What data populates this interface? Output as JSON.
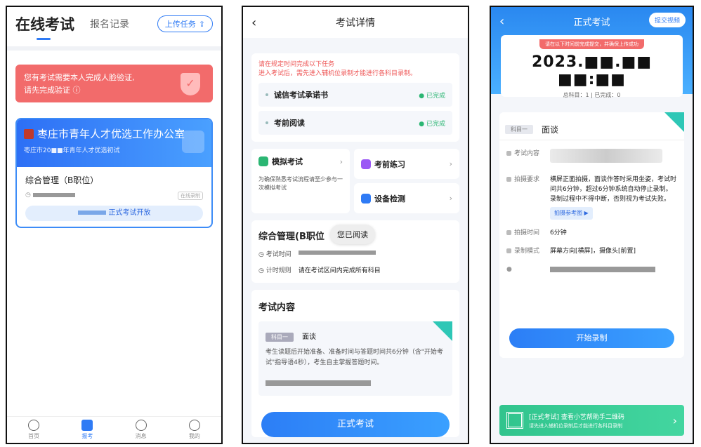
{
  "p1": {
    "title": "在线考试",
    "tab2": "报名记录",
    "upload": "上传任务",
    "alert_line1": "您有考试需要本人完成人脸验证,",
    "alert_line2": "请先完成验证",
    "org": "枣庄市青年人才优选工作办公室",
    "org_sub": "枣庄市20■■年青年人才优选初试",
    "subject": "综合管理（B职位）",
    "rec_tag": "在线录制",
    "open": "正式考试开放",
    "tabs": [
      "首页",
      "报考",
      "消息",
      "我的"
    ]
  },
  "p2": {
    "title": "考试详情",
    "note1": "请在规定时间完成以下任务",
    "note2": "进入考试后，需先进入辅机位录制才能进行各科目录制。",
    "tasks": [
      {
        "label": "诚信考试承诺书",
        "status": "已完成"
      },
      {
        "label": "考前阅读",
        "status": "已完成"
      }
    ],
    "mock": "模拟考试",
    "mock_desc": "为确保熟悉考试流程请至少参与一次模拟考试",
    "practice": "考前练习",
    "device": "设备检测",
    "info_title": "综合管理(B职位",
    "bubble": "您已阅读",
    "exam_time_k": "考试时间",
    "timing_k": "计时规则",
    "timing_v": "请在考试区间内完成所有科目",
    "content_title": "考试内容",
    "subj_tag": "科目一",
    "subj_name": "面谈",
    "subj_desc": "考生读题后开始准备、准备时间与答题时间共6分钟（含\"开始考试\"指导语4秒），考生自主掌握答题时间。",
    "start": "正式考试"
  },
  "p3": {
    "title": "正式考试",
    "submit": "提交视频",
    "banner": "请在以下时间前完成提交，并确保上传成功",
    "date": "2023.■■.■■ ■■:■■",
    "count": "总科目：1 | 已完成：0",
    "subj_tag": "科目一",
    "subj_name": "面谈",
    "k_content": "考试内容",
    "k_req": "拍摄要求",
    "v_req": "横屏正面拍摄，面谈作答时采用坐姿，考试时间共6分钟，超过6分钟系统自动停止录制。录制过程中不得中断，否则视为考试失败。",
    "ref": "拍摄参考图 ▶",
    "k_time": "拍摄时间",
    "v_time": "6分钟",
    "k_mode": "录制模式",
    "v_mode": "屏幕方向[横屏]，摄像头[前置]",
    "record": "开始录制",
    "qr1": "[正式考试] 查看小艺帮助手二维码",
    "qr2": "请先进入辅机位录制后才能进行各科目录制"
  },
  "colors": {
    "accent": "#2f7bf5",
    "alert": "#f26b6b",
    "success": "#2bb673",
    "qr": "#31c48d"
  }
}
